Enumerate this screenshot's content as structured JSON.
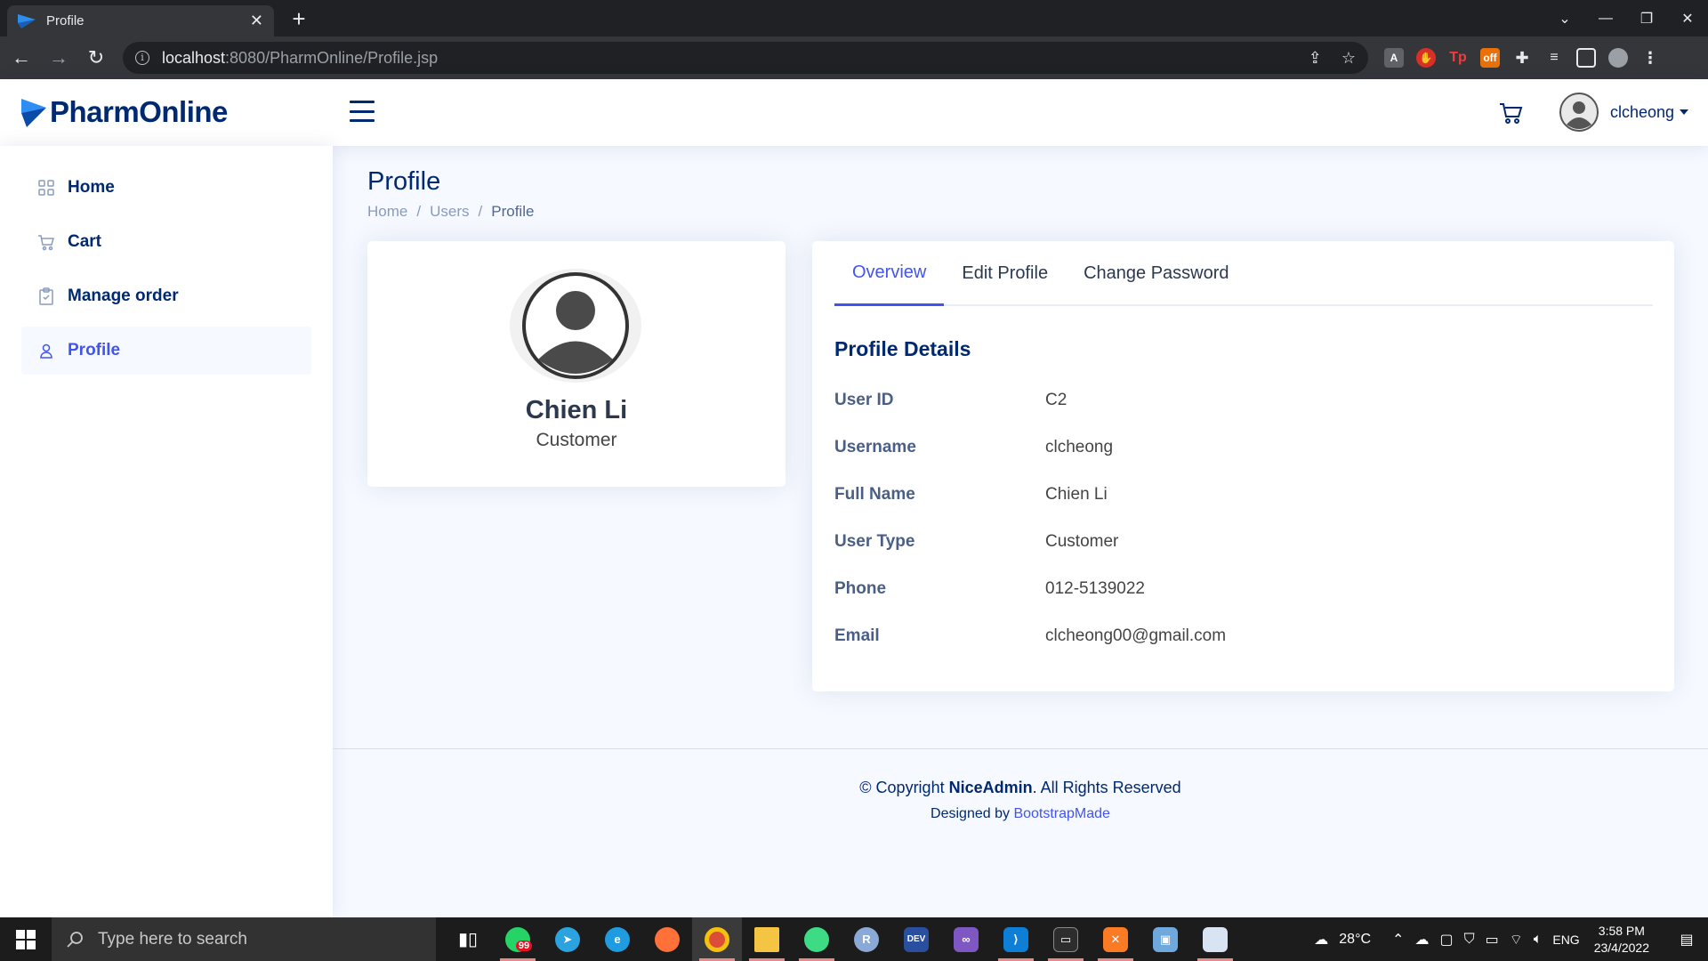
{
  "browser": {
    "tab_title": "Profile",
    "url_host": "localhost",
    "url_path": ":8080/PharmOnline/Profile.jsp"
  },
  "header": {
    "brand": "PharmOnline",
    "username": "clcheong"
  },
  "sidebar": {
    "items": [
      {
        "label": "Home",
        "icon": "grid-icon"
      },
      {
        "label": "Cart",
        "icon": "cart-icon"
      },
      {
        "label": "Manage order",
        "icon": "clipboard-icon"
      },
      {
        "label": "Profile",
        "icon": "person-icon",
        "active": true
      }
    ]
  },
  "page": {
    "title": "Profile",
    "breadcrumb": [
      "Home",
      "Users",
      "Profile"
    ]
  },
  "profile_card": {
    "name": "Chien Li",
    "type": "Customer"
  },
  "tabs": [
    "Overview",
    "Edit Profile",
    "Change Password"
  ],
  "details": {
    "title": "Profile Details",
    "rows": [
      {
        "label": "User ID",
        "value": "C2"
      },
      {
        "label": "Username",
        "value": "clcheong"
      },
      {
        "label": "Full Name",
        "value": "Chien Li"
      },
      {
        "label": "User Type",
        "value": "Customer"
      },
      {
        "label": "Phone",
        "value": "012-5139022"
      },
      {
        "label": "Email",
        "value": "clcheong00@gmail.com"
      }
    ]
  },
  "footer": {
    "copyright_prefix": "© Copyright ",
    "copyright_brand": "NiceAdmin",
    "copyright_suffix": ". All Rights Reserved",
    "designed_prefix": "Designed by ",
    "designed_link": "BootstrapMade"
  },
  "taskbar": {
    "search_placeholder": "Type here to search",
    "whatsapp_badge": "99",
    "weather": "28°C",
    "lang": "ENG",
    "time": "3:58 PM",
    "date": "23/4/2022"
  },
  "colors": {
    "brand": "#012970",
    "accent": "#4154f1",
    "background": "#f6f9ff"
  }
}
